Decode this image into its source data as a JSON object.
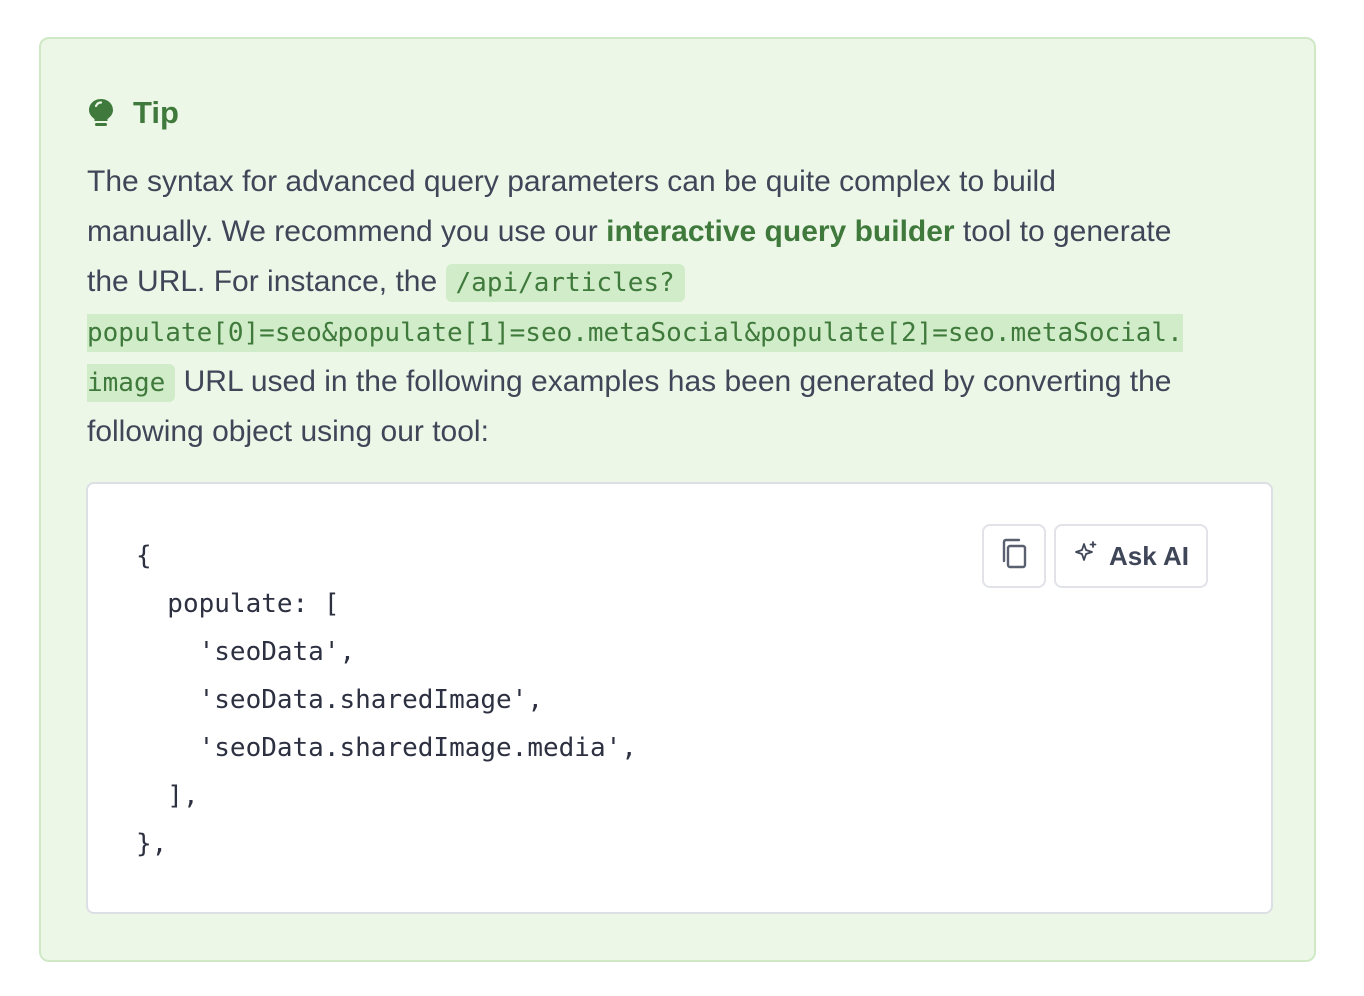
{
  "tip": {
    "icon": "lightbulb-icon",
    "title": "Tip",
    "accent_color": "#3f7a3c",
    "body": {
      "line1": "The syntax for advanced query parameters can be quite complex to build",
      "line2_before": "manually. We recommend you use our ",
      "link_text": "interactive query builder",
      "line2_after": " tool to generate",
      "line3_before": "the URL. For instance, the ",
      "code_part1": "/api/articles?",
      "code_part2": "populate[0]=seo&populate[1]=seo.metaSocial&populate[2]=seo.metaSocial.",
      "code_part3": "image",
      "line5_after": " URL used in the following examples has been generated by converting the",
      "line6": "following object using our tool:"
    }
  },
  "code_block": {
    "code": "{\n  populate: [\n    'seoData',\n    'seoData.sharedImage',\n    'seoData.sharedImage.media',\n  ],\n},",
    "copy_icon": "copy-icon",
    "ask_ai_icon": "sparkle-icon",
    "ask_ai_label": "Ask AI"
  }
}
